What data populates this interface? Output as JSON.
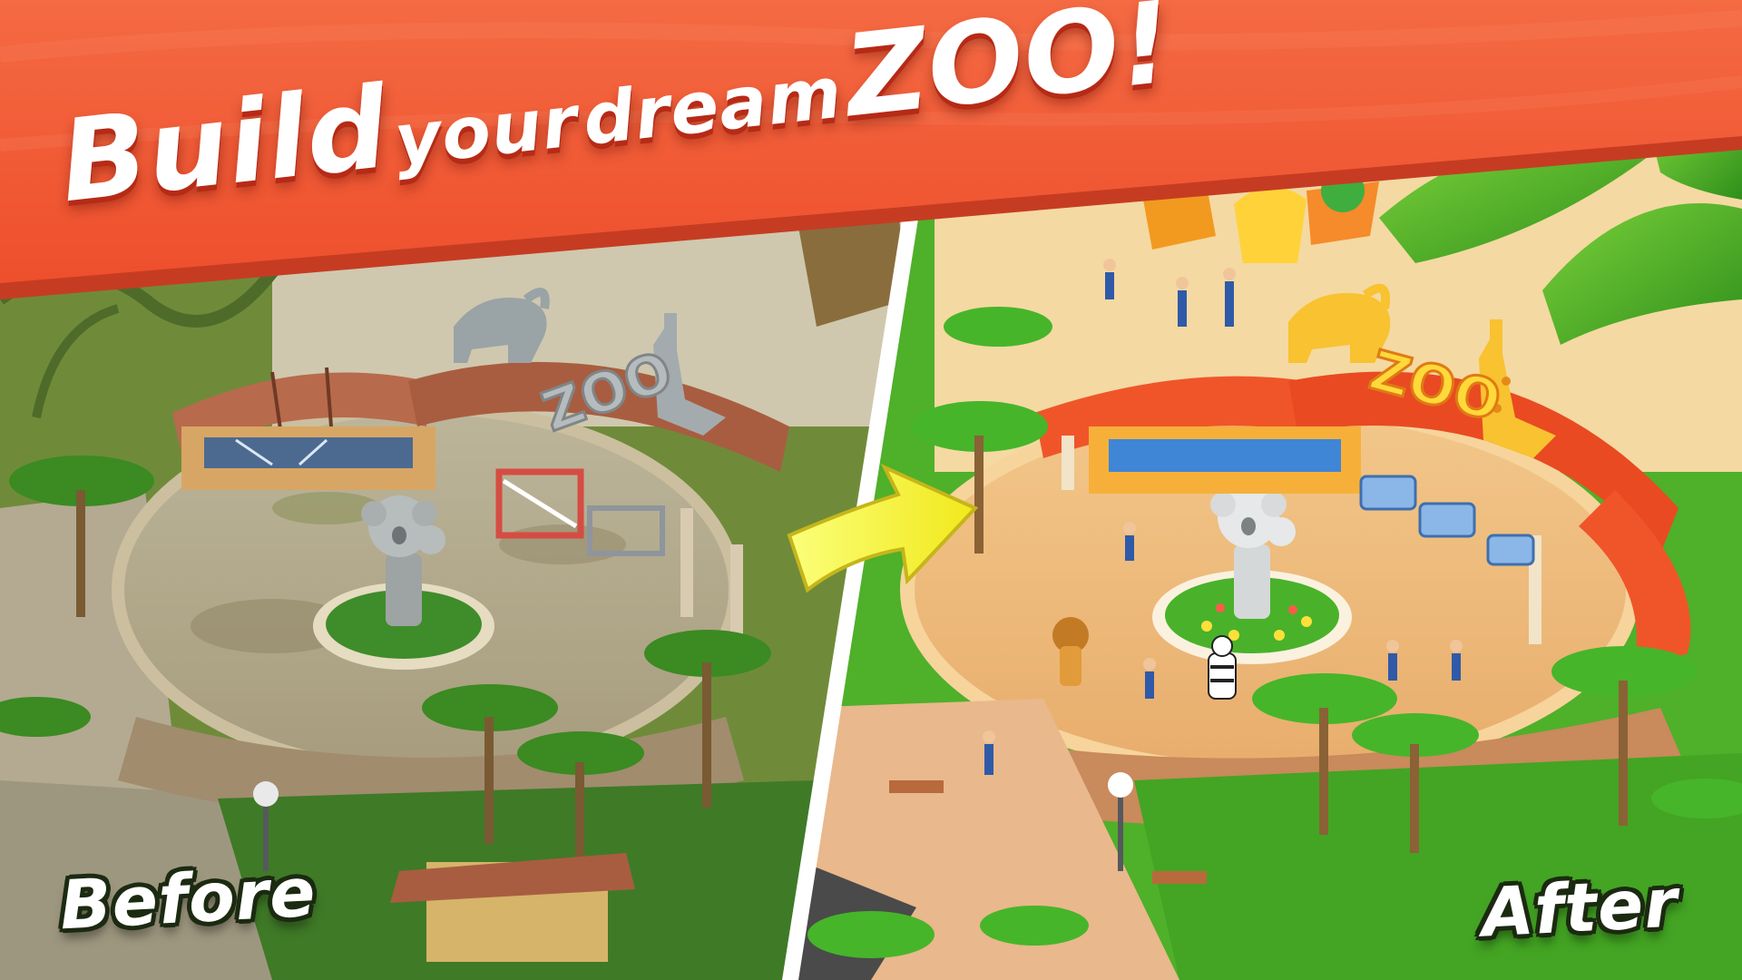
{
  "banner": {
    "word_build": "Build",
    "word_your": "your",
    "word_dream": "dream",
    "word_zoo": "ZOO!"
  },
  "before_panel": {
    "label": "Before",
    "sign_text": "ZOO"
  },
  "after_panel": {
    "label": "After",
    "sign_text": "ZOO"
  },
  "colors": {
    "banner_red": "#f05a37",
    "banner_shadow": "#c63c22",
    "arrow_yellow": "#f6ef2a",
    "divider_white": "#ffffff",
    "grass_after": "#4fb02a",
    "grass_before": "#6f8b3a",
    "roof_after": "#f0552a",
    "roof_before": "#b86a4c"
  },
  "icons": [
    "transform-arrow-icon"
  ]
}
